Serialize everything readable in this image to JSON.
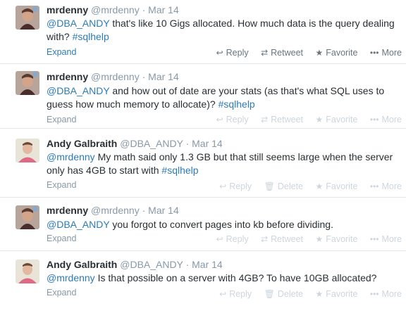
{
  "actions": {
    "reply": "Reply",
    "retweet": "Retweet",
    "delete": "Delete",
    "favorite": "Favorite",
    "more": "More",
    "expand": "Expand"
  },
  "tweets": [
    {
      "fullname": "mrdenny",
      "username": "@mrdenny",
      "date": "Mar 14",
      "segments": [
        {
          "t": "@DBA_ANDY",
          "l": true
        },
        {
          "t": " that's like 10 Gigs allocated. How much data is the query dealing with? ",
          "l": false
        },
        {
          "t": "#sqlhelp",
          "l": true
        }
      ]
    },
    {
      "fullname": "mrdenny",
      "username": "@mrdenny",
      "date": "Mar 14",
      "segments": [
        {
          "t": "@DBA_ANDY",
          "l": true
        },
        {
          "t": " and how out of date are your stats (as that's what SQL uses to guess how much memory to allocate)? ",
          "l": false
        },
        {
          "t": "#sqlhelp",
          "l": true
        }
      ]
    },
    {
      "fullname": "Andy Galbraith",
      "username": "@DBA_ANDY",
      "date": "Mar 14",
      "segments": [
        {
          "t": "@mrdenny",
          "l": true
        },
        {
          "t": " My math said only 1.3 GB but that still seems large when the server only has 4GB to start with ",
          "l": false
        },
        {
          "t": "#sqlhelp",
          "l": true
        }
      ]
    },
    {
      "fullname": "mrdenny",
      "username": "@mrdenny",
      "date": "Mar 14",
      "segments": [
        {
          "t": "@DBA_ANDY",
          "l": true
        },
        {
          "t": " you forgot to convert pages into kb before dividing.",
          "l": false
        }
      ]
    },
    {
      "fullname": "Andy Galbraith",
      "username": "@DBA_ANDY",
      "date": "Mar 14",
      "segments": [
        {
          "t": "@mrdenny",
          "l": true
        },
        {
          "t": " Is that possible on a server with 4GB?  To have 10GB allocated?",
          "l": false
        }
      ]
    }
  ]
}
